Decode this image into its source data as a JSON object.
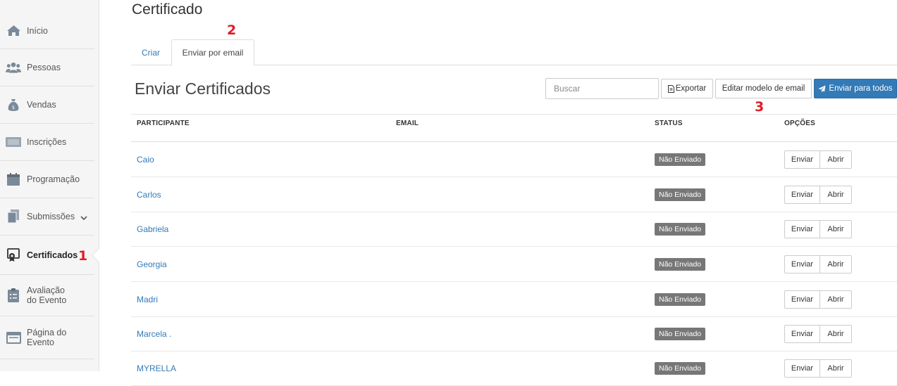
{
  "sidebar": {
    "items": [
      {
        "label": "Início",
        "icon": "home-icon"
      },
      {
        "label": "Pessoas",
        "icon": "people-icon"
      },
      {
        "label": "Vendas",
        "icon": "money-bag-icon"
      },
      {
        "label": "Inscrições",
        "icon": "ticket-icon"
      },
      {
        "label": "Programação",
        "icon": "calendar-icon"
      },
      {
        "label": "Submissões",
        "icon": "documents-icon"
      },
      {
        "label": "Certificados",
        "icon": "certificate-icon"
      },
      {
        "label": "Avaliação do Evento",
        "icon": "clipboard-icon"
      },
      {
        "label": "Página do Evento",
        "icon": "browser-window-icon"
      }
    ]
  },
  "annotations": {
    "one": "1",
    "two": "2",
    "three": "3"
  },
  "page": {
    "title": "Certificado"
  },
  "tabs": {
    "create": "Criar",
    "email": "Enviar por email"
  },
  "section": {
    "title": "Enviar Certificados"
  },
  "toolbar": {
    "search_placeholder": "Buscar",
    "export_label": "Exportar",
    "edit_template_label": "Editar modelo de email",
    "send_all_label": "Enviar para todos"
  },
  "table": {
    "headers": {
      "participant": "PARTICIPANTE",
      "email": "EMAIL",
      "status": "STATUS",
      "options": "OPÇÕES"
    },
    "rows": [
      {
        "name": "Caio",
        "status": "Não Enviado",
        "send": "Enviar",
        "open": "Abrir"
      },
      {
        "name": "Carlos",
        "status": "Não Enviado",
        "send": "Enviar",
        "open": "Abrir"
      },
      {
        "name": "Gabriela",
        "status": "Não Enviado",
        "send": "Enviar",
        "open": "Abrir"
      },
      {
        "name": "Georgia",
        "status": "Não Enviado",
        "send": "Enviar",
        "open": "Abrir"
      },
      {
        "name": "Madri",
        "status": "Não Enviado",
        "send": "Enviar",
        "open": "Abrir"
      },
      {
        "name": "Marcela .",
        "status": "Não Enviado",
        "send": "Enviar",
        "open": "Abrir"
      },
      {
        "name": "MYRELLA",
        "status": "Não Enviado",
        "send": "Enviar",
        "open": "Abrir"
      }
    ]
  },
  "colors": {
    "primary": "#337ab7",
    "badge": "#777777",
    "annotation": "#e01b24"
  }
}
